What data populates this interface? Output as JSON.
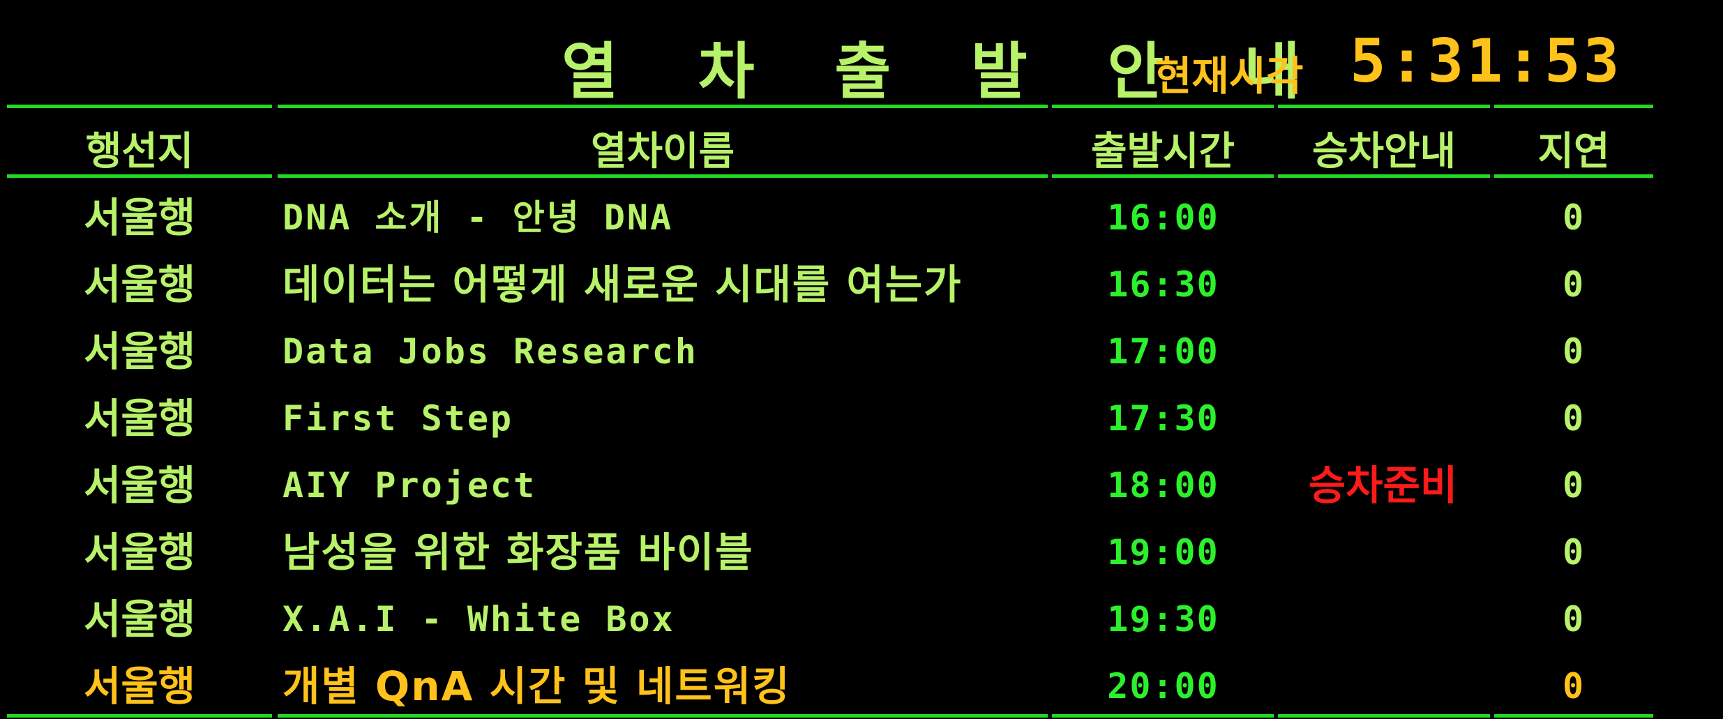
{
  "header": {
    "title": "열 차 출 발 안 내",
    "clock_label": "현재시각",
    "clock_time": "5:31:53"
  },
  "columns": {
    "destination": "행선지",
    "train_name": "열차이름",
    "departure": "출발시간",
    "boarding": "승차안내",
    "delay": "지연"
  },
  "colors": {
    "text_green": "#b7f26a",
    "time_green": "#2cf02c",
    "rule_green": "#22d822",
    "highlight_yellow": "#ffc21a",
    "boarding_red": "#ff1a1a",
    "background": "#000000"
  },
  "rows": [
    {
      "destination": "서울행",
      "name": "DNA 소개 - 안녕 DNA",
      "time": "16:00",
      "boarding": "",
      "delay": "0"
    },
    {
      "destination": "서울행",
      "name": "데이터는 어떻게 새로운 시대를 여는가",
      "time": "16:30",
      "boarding": "",
      "delay": "0"
    },
    {
      "destination": "서울행",
      "name": "Data Jobs Research",
      "time": "17:00",
      "boarding": "",
      "delay": "0"
    },
    {
      "destination": "서울행",
      "name": "First Step",
      "time": "17:30",
      "boarding": "",
      "delay": "0"
    },
    {
      "destination": "서울행",
      "name": "AIY Project",
      "time": "18:00",
      "boarding": "승차준비",
      "delay": "0"
    },
    {
      "destination": "서울행",
      "name": "남성을 위한 화장품 바이블",
      "time": "19:00",
      "boarding": "",
      "delay": "0"
    },
    {
      "destination": "서울행",
      "name": "X.A.I - White Box",
      "time": "19:30",
      "boarding": "",
      "delay": "0"
    },
    {
      "destination": "서울행",
      "name": "개별 QnA 시간 및 네트워킹",
      "time": "20:00",
      "boarding": "",
      "delay": "0"
    }
  ]
}
